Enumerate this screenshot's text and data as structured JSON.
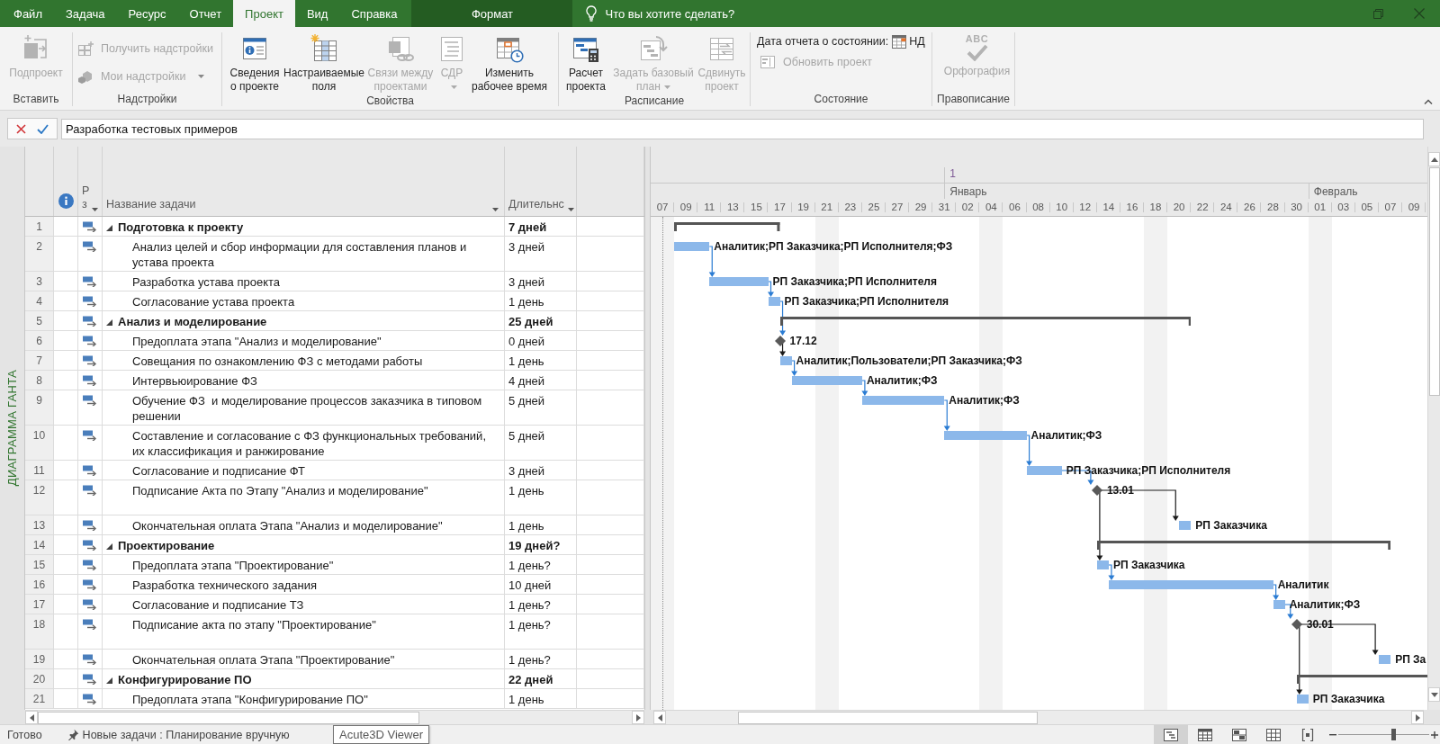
{
  "tabs": [
    {
      "label": "Файл",
      "kind": "normal",
      "selected": false
    },
    {
      "label": "Задача",
      "kind": "normal",
      "selected": false
    },
    {
      "label": "Ресурс",
      "kind": "normal",
      "selected": false
    },
    {
      "label": "Отчет",
      "kind": "normal",
      "selected": false
    },
    {
      "label": "Проект",
      "kind": "normal",
      "selected": true
    },
    {
      "label": "Вид",
      "kind": "normal",
      "selected": false
    },
    {
      "label": "Справка",
      "kind": "normal",
      "selected": false
    },
    {
      "label": "Формат",
      "kind": "contextual",
      "selected": false
    }
  ],
  "tell_me": {
    "placeholder": "Что вы хотите сделать?"
  },
  "ribbon": {
    "groups": [
      {
        "label": "Вставить",
        "controls": [
          {
            "kind": "large",
            "label": "Подпроект",
            "disabled": true,
            "dropdown": false
          }
        ]
      },
      {
        "label": "Надстройки",
        "controls": [
          {
            "kind": "small",
            "label": "Получить надстройки",
            "disabled": true,
            "dropdown": false
          },
          {
            "kind": "small",
            "label": "Мои надстройки",
            "disabled": true,
            "dropdown": true
          }
        ]
      },
      {
        "label": "Свойства",
        "controls": [
          {
            "kind": "large",
            "label": "Сведения о проекте",
            "disabled": false,
            "dropdown": false
          },
          {
            "kind": "large",
            "label": "Настраиваемые поля",
            "disabled": false,
            "dropdown": false
          },
          {
            "kind": "large",
            "label": "Связи между проектами",
            "disabled": true,
            "dropdown": false
          },
          {
            "kind": "large",
            "label": "СДР",
            "disabled": true,
            "dropdown": true
          },
          {
            "kind": "large",
            "label": "Изменить рабочее время",
            "disabled": false,
            "dropdown": false
          }
        ]
      },
      {
        "label": "Расписание",
        "controls": [
          {
            "kind": "large",
            "label": "Расчет проекта",
            "disabled": false,
            "dropdown": false
          },
          {
            "kind": "large",
            "label": "Задать базовый план",
            "disabled": true,
            "dropdown": true
          },
          {
            "kind": "large",
            "label": "Сдвинуть проект",
            "disabled": true,
            "dropdown": false
          }
        ]
      },
      {
        "label": "Состояние",
        "controls": [
          {
            "kind": "date",
            "label": "Дата отчета о состоянии:",
            "value": "НД",
            "disabled": false
          },
          {
            "kind": "small",
            "label": "Обновить проект",
            "disabled": true,
            "dropdown": false
          }
        ]
      },
      {
        "label": "Правописание",
        "controls": [
          {
            "kind": "large",
            "label": "Орфография",
            "icon_text": "ABC",
            "disabled": true,
            "dropdown": false
          }
        ]
      }
    ]
  },
  "formula_bar": {
    "value": "Разработка тестовых примеров"
  },
  "view_bar": {
    "label": "ДИАГРАММА ГАНТА"
  },
  "table": {
    "columns": [
      {
        "kind": "info"
      },
      {
        "kind": "mode",
        "label": "Р з",
        "dropdown": true
      },
      {
        "kind": "name",
        "label": "Название задачи",
        "dropdown": true
      },
      {
        "kind": "duration",
        "label": "Длительнс",
        "dropdown": true
      }
    ]
  },
  "tasks": [
    {
      "id": "1",
      "name": "Подготовка к проекту",
      "duration": "7 дней",
      "blank_line": false,
      "expanded": true,
      "bar": {
        "kind": "summary"
      },
      "children": [
        {
          "id": "2",
          "name": "Анализ целей и сбор информации для составления планов и устава проекта",
          "duration": "3 дней",
          "blank_line": false,
          "bar": {
            "kind": "task",
            "resources": "Аналитик;РП Заказчика;РП Исполнителя;ФЗ"
          }
        },
        {
          "id": "3",
          "name": "Разработка устава проекта",
          "duration": "3 дней",
          "blank_line": false,
          "bar": {
            "kind": "task",
            "resources": "РП Заказчика;РП Исполнителя"
          }
        },
        {
          "id": "4",
          "name": "Согласование устава проекта",
          "duration": "1 день",
          "blank_line": false,
          "bar": {
            "kind": "task",
            "resources": "РП Заказчика;РП Исполнителя"
          }
        }
      ]
    },
    {
      "id": "5",
      "name": "Анализ и моделирование",
      "duration": "25 дней",
      "blank_line": false,
      "expanded": true,
      "bar": {
        "kind": "summary"
      },
      "children": [
        {
          "id": "6",
          "name": "Предоплата этапа \"Анализ и моделирование\"",
          "duration": "0 дней",
          "blank_line": false,
          "bar": {
            "kind": "milestone",
            "label": "17.12"
          }
        },
        {
          "id": "7",
          "name": "Совещания по ознакомлению ФЗ с методами работы",
          "duration": "1 день",
          "blank_line": false,
          "bar": {
            "kind": "task",
            "resources": "Аналитик;Пользователи;РП Заказчика;ФЗ"
          }
        },
        {
          "id": "8",
          "name": "Интервьюирование ФЗ",
          "duration": "4 дней",
          "blank_line": false,
          "bar": {
            "kind": "task",
            "resources": "Аналитик;ФЗ"
          }
        },
        {
          "id": "9",
          "name": "Обучение ФЗ  и моделирование процессов заказчика в типовом решении",
          "duration": "5 дней",
          "blank_line": false,
          "bar": {
            "kind": "task",
            "resources": "Аналитик;ФЗ"
          }
        },
        {
          "id": "10",
          "name": "Составление и согласование с ФЗ функциональных требований, их классификация и ранжирование",
          "duration": "5 дней",
          "blank_line": false,
          "bar": {
            "kind": "task",
            "resources": "Аналитик;ФЗ"
          }
        },
        {
          "id": "11",
          "name": "Согласование и подписание ФТ",
          "duration": "3 дней",
          "blank_line": false,
          "bar": {
            "kind": "task",
            "resources": "РП Заказчика;РП Исполнителя"
          }
        },
        {
          "id": "12",
          "name": "Подписание Акта по Этапу \"Анализ и моделирование\"",
          "duration": "1 день",
          "blank_line": true,
          "bar": {
            "kind": "milestone",
            "label": "13.01"
          }
        },
        {
          "id": "13",
          "name": "Окончательная оплата Этапа \"Анализ и моделирование\"",
          "duration": "1 день",
          "blank_line": false,
          "bar": {
            "kind": "task",
            "resources": "РП Заказчика"
          }
        }
      ]
    },
    {
      "id": "14",
      "name": "Проектирование",
      "duration": "19 дней?",
      "blank_line": false,
      "expanded": true,
      "bar": {
        "kind": "summary"
      },
      "children": [
        {
          "id": "15",
          "name": "Предоплата этапа \"Проектирование\"",
          "duration": "1 день?",
          "blank_line": false,
          "bar": {
            "kind": "task",
            "resources": "РП Заказчика"
          }
        },
        {
          "id": "16",
          "name": "Разработка технического задания",
          "duration": "10 дней",
          "blank_line": false,
          "bar": {
            "kind": "task",
            "resources": "Аналитик"
          }
        },
        {
          "id": "17",
          "name": "Согласование и подписание ТЗ",
          "duration": "1 день?",
          "blank_line": false,
          "bar": {
            "kind": "task",
            "resources": "Аналитик;ФЗ"
          }
        },
        {
          "id": "18",
          "name": "Подписание акта по этапу \"Проектирование\"",
          "duration": "1 день?",
          "blank_line": true,
          "bar": {
            "kind": "milestone",
            "label": "30.01"
          }
        },
        {
          "id": "19",
          "name": "Окончательная оплата Этапа \"Проектирование\"",
          "duration": "1 день?",
          "blank_line": false,
          "bar": {
            "kind": "task",
            "resources": "РП За"
          }
        }
      ]
    },
    {
      "id": "20",
      "name": "Конфигурирование ПО",
      "duration": "22 дней",
      "blank_line": false,
      "expanded": true,
      "bar": {
        "kind": "summary"
      },
      "children": [
        {
          "id": "21",
          "name": "Предоплата этапа \"Конфигурирование ПО\"",
          "duration": "1 день",
          "blank_line": false,
          "bar": {
            "kind": "task",
            "resources": "РП Заказчика"
          }
        }
      ]
    }
  ],
  "timescale": {
    "top_tier": [
      {
        "label": "1"
      }
    ],
    "months": [
      {
        "label": "Январь"
      },
      {
        "label": "Февраль"
      }
    ],
    "days": [
      {
        "label": "07",
        "shaded": true
      },
      {
        "label": "09",
        "shaded": false
      },
      {
        "label": "11",
        "shaded": false
      },
      {
        "label": "13",
        "shaded": false
      },
      {
        "label": "15",
        "shaded": false
      },
      {
        "label": "17",
        "shaded": false
      },
      {
        "label": "19",
        "shaded": false
      },
      {
        "label": "21",
        "shaded": true
      },
      {
        "label": "23",
        "shaded": false
      },
      {
        "label": "25",
        "shaded": false
      },
      {
        "label": "27",
        "shaded": false
      },
      {
        "label": "29",
        "shaded": false
      },
      {
        "label": "31",
        "shaded": false
      },
      {
        "label": "02",
        "shaded": false
      },
      {
        "label": "04",
        "shaded": true
      },
      {
        "label": "06",
        "shaded": false
      },
      {
        "label": "08",
        "shaded": false
      },
      {
        "label": "10",
        "shaded": false
      },
      {
        "label": "12",
        "shaded": false
      },
      {
        "label": "14",
        "shaded": false
      },
      {
        "label": "16",
        "shaded": false
      },
      {
        "label": "18",
        "shaded": true
      },
      {
        "label": "20",
        "shaded": false
      },
      {
        "label": "22",
        "shaded": false
      },
      {
        "label": "24",
        "shaded": false
      },
      {
        "label": "26",
        "shaded": false
      },
      {
        "label": "28",
        "shaded": false
      },
      {
        "label": "30",
        "shaded": false
      },
      {
        "label": "01",
        "shaded": true
      },
      {
        "label": "03",
        "shaded": false
      },
      {
        "label": "05",
        "shaded": false
      },
      {
        "label": "07",
        "shaded": false
      },
      {
        "label": "09",
        "shaded": false
      }
    ]
  },
  "status_bar": {
    "ready": "Готово",
    "new_tasks": "Новые задачи : Планирование вручную",
    "views": [
      {
        "selected": true
      },
      {
        "selected": false
      },
      {
        "selected": false
      },
      {
        "selected": false
      },
      {
        "selected": false
      }
    ],
    "zoom": {
      "level": 0.6
    }
  },
  "tooltip": {
    "text": "Acute3D Viewer"
  }
}
